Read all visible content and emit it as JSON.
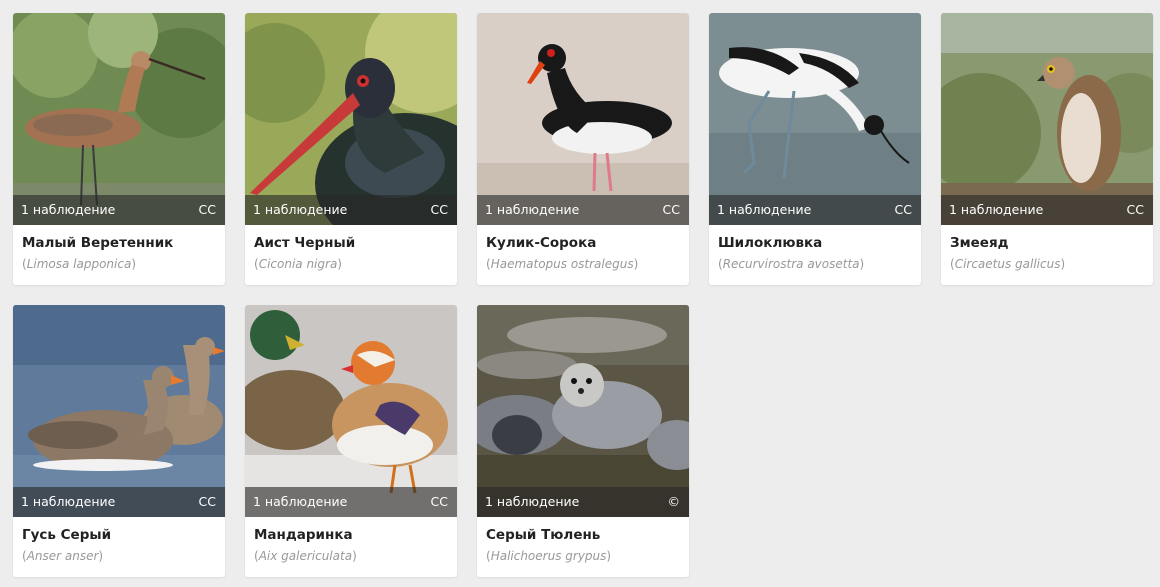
{
  "cards": [
    {
      "common": "Малый Веретенник",
      "sci_open": "(",
      "sci": "Limosa lapponica",
      "sci_close": ")",
      "observations": "1 наблюдение",
      "license": "CC"
    },
    {
      "common": "Аист Черный",
      "sci_open": "(",
      "sci": "Ciconia nigra",
      "sci_close": ")",
      "observations": "1 наблюдение",
      "license": "CC"
    },
    {
      "common": "Кулик-Сорока",
      "sci_open": "(",
      "sci": "Haematopus ostralegus",
      "sci_close": ")",
      "observations": "1 наблюдение",
      "license": "CC"
    },
    {
      "common": "Шилоклювка",
      "sci_open": "(",
      "sci": "Recurvirostra avosetta",
      "sci_close": ")",
      "observations": "1 наблюдение",
      "license": "CC"
    },
    {
      "common": "Змееяд",
      "sci_open": "(",
      "sci": "Circaetus gallicus",
      "sci_close": ")",
      "observations": "1 наблюдение",
      "license": "CC"
    },
    {
      "common": "Гусь Серый",
      "sci_open": "(",
      "sci": "Anser anser",
      "sci_close": ")",
      "observations": "1 наблюдение",
      "license": "CC"
    },
    {
      "common": "Мандаринка",
      "sci_open": "(",
      "sci": "Aix galericulata",
      "sci_close": ")",
      "observations": "1 наблюдение",
      "license": "CC"
    },
    {
      "common": "Серый Тюлень",
      "sci_open": "(",
      "sci": "Halichoerus grypus",
      "sci_close": ")",
      "observations": "1 наблюдение",
      "license": "©"
    }
  ]
}
